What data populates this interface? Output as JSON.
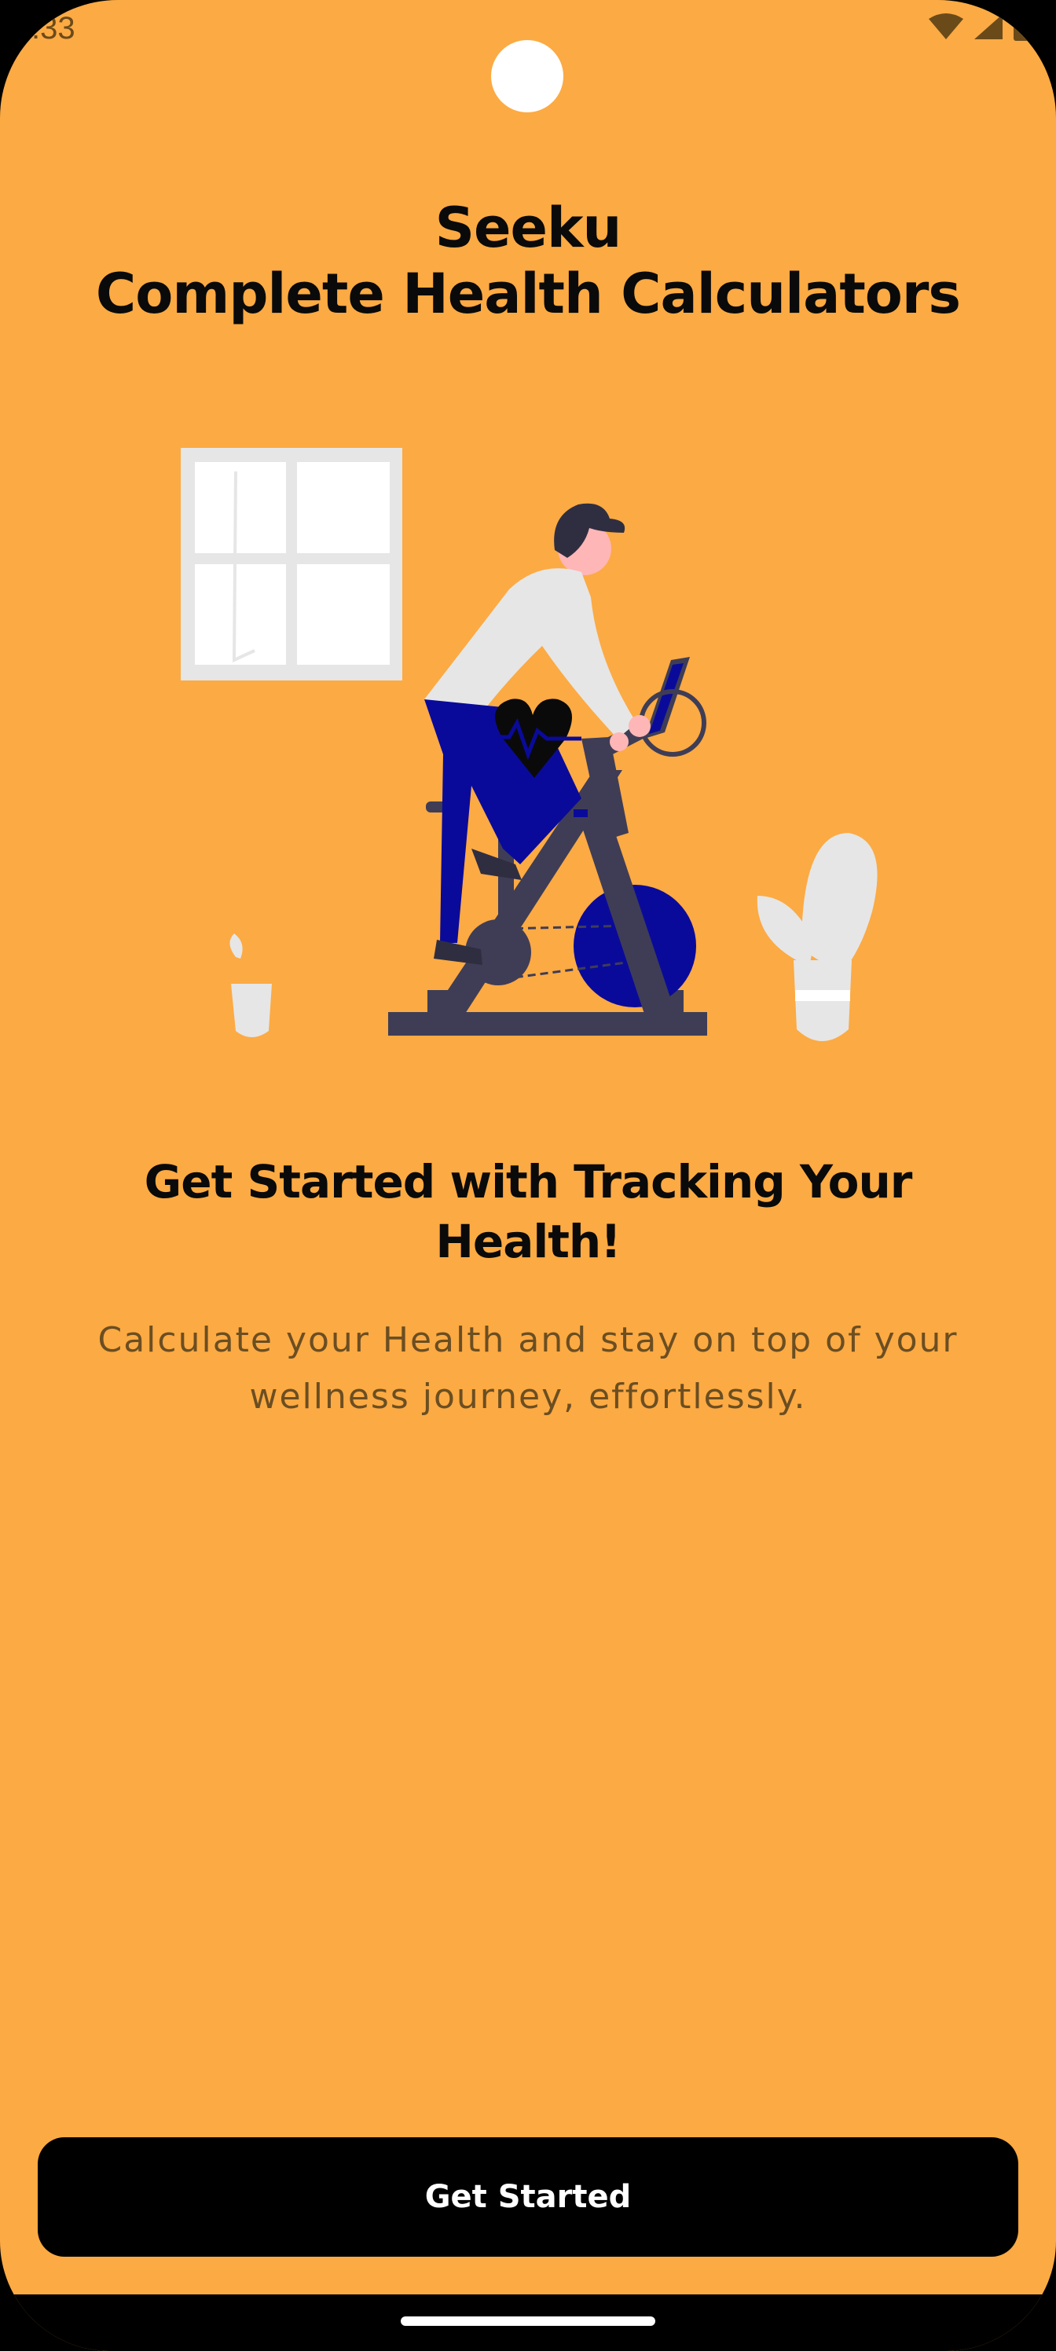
{
  "status_bar": {
    "time": ":33",
    "icons": [
      "wifi-icon",
      "cellular-signal-icon",
      "battery-icon"
    ]
  },
  "app_title": {
    "line1": "Seeku",
    "line2": "Complete Health Calculators"
  },
  "illustration": {
    "name": "exercise-bike-illustration",
    "colors": {
      "background": "#FCAA43",
      "accent": "#0A0A9A",
      "frame": "#3F3D56",
      "light": "#E6E6E6",
      "skin": "#FFB6B6"
    }
  },
  "onboarding": {
    "headline": "Get Started with Tracking Your Health!",
    "subtext": "Calculate your Health and stay on top of your wellness journey, effortlessly."
  },
  "cta": {
    "label": "Get Started"
  }
}
